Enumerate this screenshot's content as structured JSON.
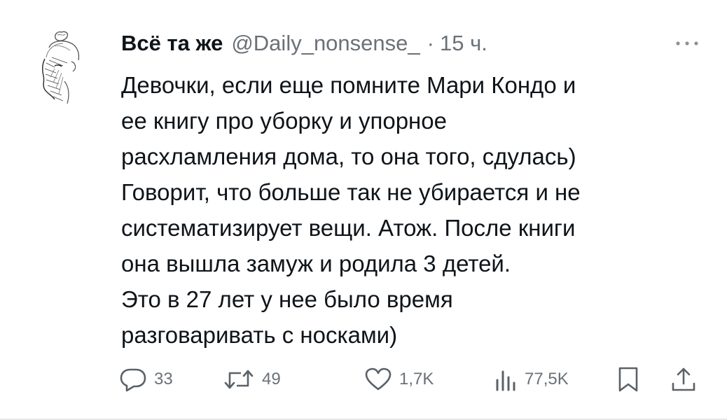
{
  "tweet": {
    "display_name": "Всё та же",
    "handle": "@Daily_nonsense_",
    "separator": "·",
    "time": "15 ч.",
    "lines": [
      "Девочки, если еще помните Мари Кондо и",
      "ее книгу про уборку и упорное",
      "расхламления дома, то она того, сдулась)",
      "Говорит, что больше так не убирается и не",
      "систематизирует вещи. Атож. После книги",
      "она вышла замуж и родила 3 детей.",
      "Это в 27 лет у нее было время",
      "разговаривать с носками)"
    ]
  },
  "actions": {
    "replies": "33",
    "retweets": "49",
    "likes": "1,7K",
    "views": "77,5K"
  },
  "icons": {
    "avatar": "sketch-woman-portrait",
    "more": "more-dots-icon",
    "reply": "reply-bubble-icon",
    "retweet": "retweet-arrows-icon",
    "like": "heart-icon",
    "views": "views-bars-icon",
    "bookmark": "bookmark-icon",
    "share": "share-icon"
  },
  "colors": {
    "text": "#0f1419",
    "secondary": "#6b7177",
    "icon": "#5b6168"
  }
}
